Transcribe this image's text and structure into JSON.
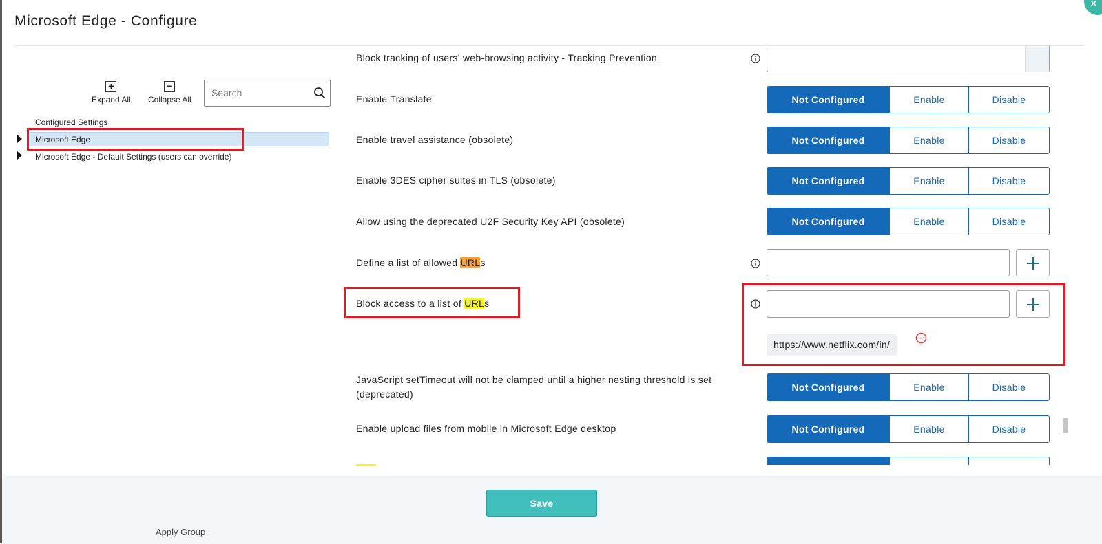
{
  "window": {
    "title": "Microsoft Edge - Configure"
  },
  "toolbar": {
    "expand_label": "Expand All",
    "expand_icon": "plus-square-icon",
    "collapse_label": "Collapse All",
    "collapse_icon": "minus-square-icon",
    "search_placeholder": "Search",
    "search_icon": "search-icon"
  },
  "tree": {
    "header": "Configured Settings",
    "items": [
      {
        "label": "Microsoft Edge",
        "selected": true
      },
      {
        "label": "Microsoft Edge - Default Settings (users can override)",
        "selected": false
      }
    ]
  },
  "options": {
    "not_configured": "Not Configured",
    "enable": "Enable",
    "disable": "Disable"
  },
  "settings": {
    "partial_top": "Block tracking of users' web-browsing activity - Tracking Prevention",
    "translate": "Enable Translate",
    "travel": "Enable travel assistance (obsolete)",
    "des": "Enable 3DES cipher suites in TLS (obsolete)",
    "u2f": "Allow using the deprecated U2F Security Key API (obsolete)",
    "allowed_urls": {
      "before": "Define a list of allowed ",
      "highlight": "URL",
      "after": "s"
    },
    "block_urls": {
      "before": "Block access to a list of ",
      "highlight": "URL",
      "after": "s",
      "entries": [
        "https://www.netflix.com/in/"
      ]
    },
    "settimeout": "JavaScript setTimeout will not be clamped until a higher nesting threshold is set (deprecated)",
    "upload_mobile": "Enable upload files from mobile in Microsoft Edge desktop"
  },
  "selected_option": "Not Configured",
  "footer": {
    "save_label": "Save"
  },
  "colors": {
    "primary": "#1469b8",
    "save": "#41bfbd",
    "highlight_red": "#e01b24",
    "url_orange": "#f6a13a",
    "url_yellow": "#f6f51d"
  },
  "background_text": "Apply Group"
}
